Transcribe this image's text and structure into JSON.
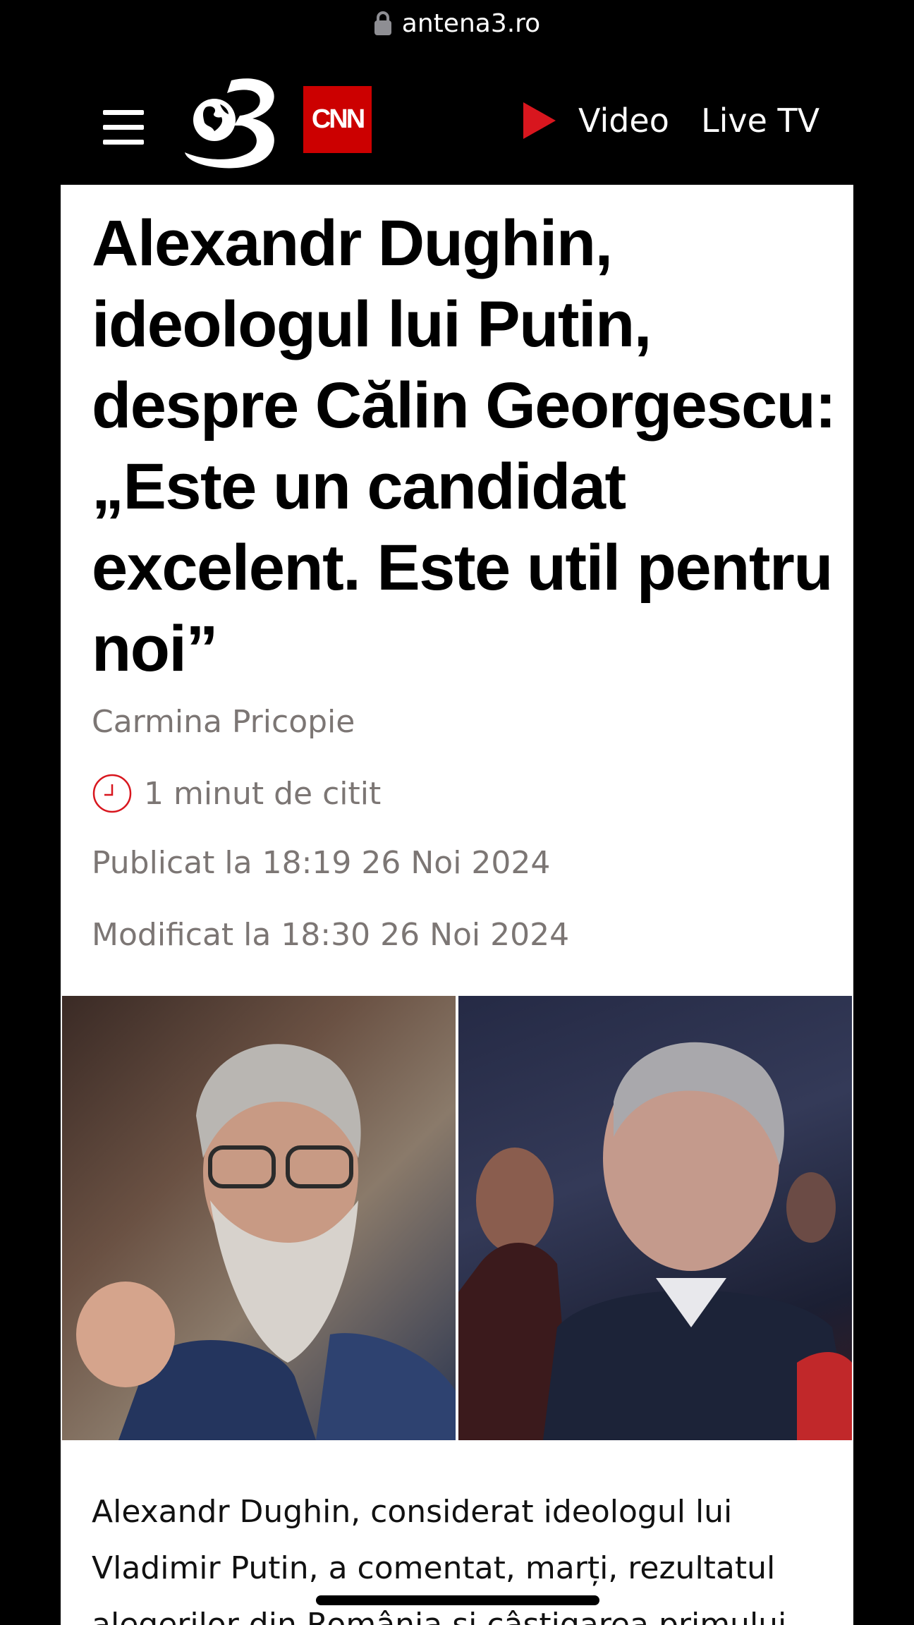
{
  "browser": {
    "url": "antena3.ro"
  },
  "header": {
    "logo_text": "3",
    "cnn_label": "CNN",
    "nav_video": "Video",
    "nav_live": "Live TV"
  },
  "article": {
    "headline": "Alexandr Dughin, ideologul lui Putin, despre Călin Georgescu: „Este un candidat excelent. Este util pentru noi”",
    "author": "Carmina Pricopie",
    "read_time": "1 minut de citit",
    "published": "Publicat la 18:19 26 Noi 2024",
    "modified": "Modificat la 18:30 26 Noi 2024",
    "body": "Alexandr Dughin, considerat ideologul lui Vladimir Putin, a comentat, marți, rezultatul alegerilor din România și câștigarea primului"
  },
  "colors": {
    "accent": "#d8161e",
    "cnn_red": "#cc0000",
    "meta_gray": "#7c7674"
  }
}
